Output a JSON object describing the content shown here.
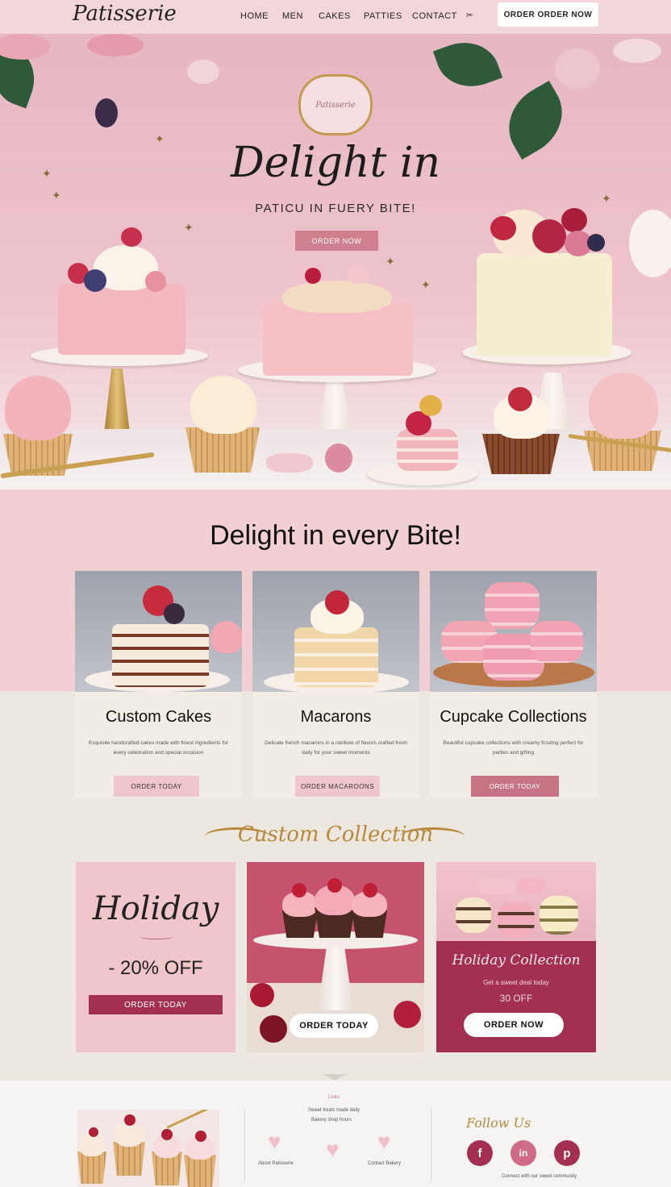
{
  "nav": {
    "logo": "Patisserie",
    "links": [
      "HOME",
      "MEN",
      "CAKES",
      "PATTIES",
      "CONTACT"
    ],
    "cta": "ORDER ORDER NOW"
  },
  "hero": {
    "badge_text": "Patisserie",
    "title": "Delight in",
    "subtitle": "PATICU IN FUERY BITE!",
    "button": "ORDER NOW"
  },
  "section": {
    "title": "Delight in every Bite!",
    "products": [
      {
        "title": "Custom Cakes",
        "desc": "Exquisite handcrafted cakes made with finest ingredients for every celebration and special occasion",
        "button": "ORDER TODAY"
      },
      {
        "title": "Macarons",
        "desc": "Delicate french macarons in a rainbow of flavors crafted fresh daily for your sweet moments",
        "button": "ORDER MACAROONS"
      },
      {
        "title": "Cupcake Collections",
        "desc": "Beautiful cupcake collections with creamy frosting perfect for parties and gifting",
        "button": "ORDER TODAY"
      }
    ]
  },
  "collection": {
    "title": "Custom Collection",
    "promo1": {
      "title": "Holiday",
      "discount": "- 20% OFF",
      "button": "ORDER TODAY"
    },
    "promo2": {
      "button": "ORDER TODAY"
    },
    "promo3": {
      "title": "Holiday Collection",
      "sub": "Get a sweet deal today",
      "off": "30 OFF",
      "button": "ORDER NOW"
    }
  },
  "footer": {
    "mid_label": "Links",
    "mid_text": [
      "Sweet treats made daily",
      "Bakery shop hours"
    ],
    "mid_links": [
      "About Patisserie",
      "Contact Bakery"
    ],
    "social_title": "Follow Us",
    "social_icons": [
      "facebook-icon",
      "instagram-icon",
      "pinterest-icon"
    ],
    "social_labels": [
      "f",
      "in",
      "p"
    ],
    "social_caption": "Connect with our sweet community"
  },
  "colors": {
    "accent": "#cf7f8d",
    "wine": "#a32f52",
    "gold": "#b8893c",
    "blush": "#f0c6cb"
  }
}
